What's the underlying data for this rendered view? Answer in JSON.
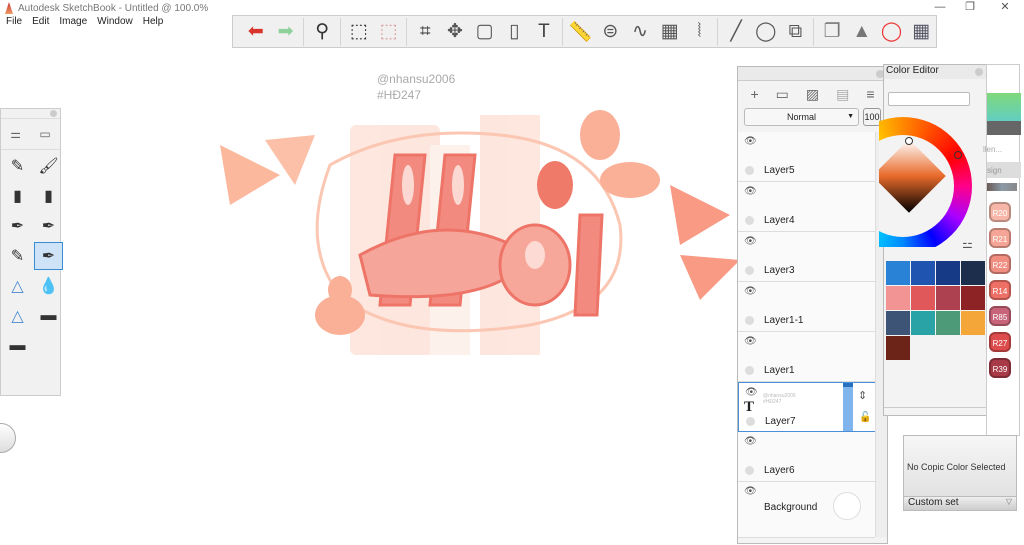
{
  "app": {
    "title": "Autodesk SketchBook - Untitled @ 100.0%"
  },
  "menu": [
    "File",
    "Edit",
    "Image",
    "Window",
    "Help"
  ],
  "toolbar": {
    "tools": [
      {
        "icon": "undo-icon",
        "glyph": "⬅",
        "color": "#d9342b"
      },
      {
        "icon": "redo-icon",
        "glyph": "➡",
        "color": "#8fd19a"
      },
      {
        "sep": true
      },
      {
        "icon": "zoom-icon",
        "glyph": "⚲",
        "color": "#333"
      },
      {
        "sep": true
      },
      {
        "icon": "select-icon",
        "glyph": "⬚",
        "color": "#333"
      },
      {
        "icon": "selection-mask-icon",
        "glyph": "⬚",
        "color": "#d99"
      },
      {
        "sep": true
      },
      {
        "icon": "crop-icon",
        "glyph": "⌗",
        "color": "#333"
      },
      {
        "icon": "transform-icon",
        "glyph": "✥",
        "color": "#555"
      },
      {
        "icon": "distort-icon",
        "glyph": "▢",
        "color": "#555"
      },
      {
        "icon": "fill-icon",
        "glyph": "▯",
        "color": "#555"
      },
      {
        "icon": "text-icon",
        "glyph": "T",
        "color": "#444"
      },
      {
        "sep": true
      },
      {
        "icon": "ruler-icon",
        "glyph": "📏",
        "color": "#555"
      },
      {
        "icon": "ellipse-guide-icon",
        "glyph": "⊜",
        "color": "#555"
      },
      {
        "icon": "french-curve-icon",
        "glyph": "∿",
        "color": "#555"
      },
      {
        "icon": "perspective-icon",
        "glyph": "▦",
        "color": "#555"
      },
      {
        "icon": "symmetry-icon",
        "glyph": "⦚",
        "color": "#555"
      },
      {
        "sep": true
      },
      {
        "icon": "line-icon",
        "glyph": "╱",
        "color": "#555"
      },
      {
        "icon": "oval-icon",
        "glyph": "◯",
        "color": "#555"
      },
      {
        "icon": "shapes-icon",
        "glyph": "⧉",
        "color": "#555"
      },
      {
        "sep": true
      },
      {
        "icon": "layers-icon",
        "glyph": "❐",
        "color": "#777"
      },
      {
        "icon": "brushes-icon",
        "glyph": "▲",
        "color": "#777"
      },
      {
        "icon": "color-wheel-icon",
        "glyph": "◯",
        "color": "#e33"
      },
      {
        "icon": "copic-library-icon",
        "glyph": "▦",
        "color": "#556"
      }
    ]
  },
  "watermark": {
    "line1": "@nhansu2006",
    "line2": "#HĐ247"
  },
  "brush_palette": {
    "brushes": [
      "pencil",
      "airbrush",
      "marker",
      "chisel",
      "ballpoint",
      "technical-pen",
      "felt-pen",
      "ink-pen",
      "triangle",
      "drop",
      "triangle-2",
      "eraser",
      "smudge"
    ],
    "selected": "ink-pen"
  },
  "layers": {
    "blend_mode": "Normal",
    "opacity": "100",
    "items": [
      {
        "name": "Layer5",
        "selected": false
      },
      {
        "name": "Layer4",
        "selected": false
      },
      {
        "name": "Layer3",
        "selected": false
      },
      {
        "name": "Layer1-1",
        "selected": false
      },
      {
        "name": "Layer1",
        "selected": false
      },
      {
        "name": "Layer7",
        "selected": true,
        "type": "text",
        "thumb_text": "@nhansu2006 #HĐ247"
      },
      {
        "name": "Layer6",
        "selected": false
      },
      {
        "name": "Background",
        "selected": false
      }
    ]
  },
  "color_editor": {
    "title": "Color Editor",
    "swatches": [
      "#2a82d6",
      "#1f55b0",
      "#163a85",
      "#1c2e4c",
      "#f29494",
      "#e0585a",
      "#ae4150",
      "#8e2326",
      "#3d5476",
      "#2aa3a6",
      "#4c9a77",
      "#f4a638",
      "#6b2417"
    ]
  },
  "copic": {
    "partial_labels": [
      "llen...",
      "sign"
    ],
    "markers": [
      {
        "code": "R20",
        "color": "#f7b7a8"
      },
      {
        "code": "R21",
        "color": "#f4a596"
      },
      {
        "code": "R22",
        "color": "#f18e82"
      },
      {
        "code": "R14",
        "color": "#ee6f66"
      },
      {
        "code": "R85",
        "color": "#c76479"
      },
      {
        "code": "R27",
        "color": "#dd4c4c"
      },
      {
        "code": "R39",
        "color": "#a83946"
      }
    ],
    "status": "No Copic Color Selected",
    "set": "Custom set"
  }
}
